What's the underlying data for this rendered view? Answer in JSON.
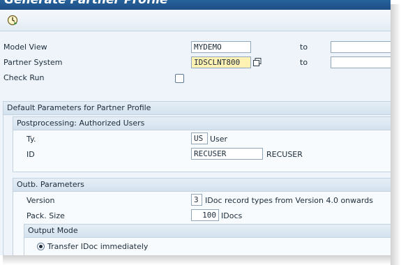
{
  "window": {
    "title": "Generate Partner Profile"
  },
  "toolbar": {
    "execute_icon": "execute-clock-icon"
  },
  "selection": {
    "model_view": {
      "label": "Model View",
      "value": "MYDEMO",
      "to_label": "to",
      "to_value": ""
    },
    "partner_system": {
      "label": "Partner System",
      "value": "IDSCLNT800",
      "to_label": "to",
      "to_value": ""
    },
    "check_run": {
      "label": "Check Run",
      "checked": false
    }
  },
  "defaults": {
    "title": "Default Parameters for Partner Profile",
    "postprocessing": {
      "title": "Postprocessing: Authorized Users",
      "type": {
        "label": "Ty.",
        "value": "US",
        "desc": "User"
      },
      "id": {
        "label": "ID",
        "value": "RECUSER",
        "desc": "RECUSER"
      }
    },
    "outbound": {
      "title": "Outb. Parameters",
      "version": {
        "label": "Version",
        "value": "3",
        "desc": "IDoc record types from Version 4.0 onwards"
      },
      "pack_size": {
        "label": "Pack. Size",
        "value": "100",
        "desc": "IDocs"
      },
      "output_mode": {
        "title": "Output Mode",
        "option": "Transfer IDoc immediately",
        "selected": true
      }
    }
  },
  "colors": {
    "title_bar": "#1d4f85",
    "highlight_field": "#fff2b3",
    "background": "#eef4f9"
  }
}
